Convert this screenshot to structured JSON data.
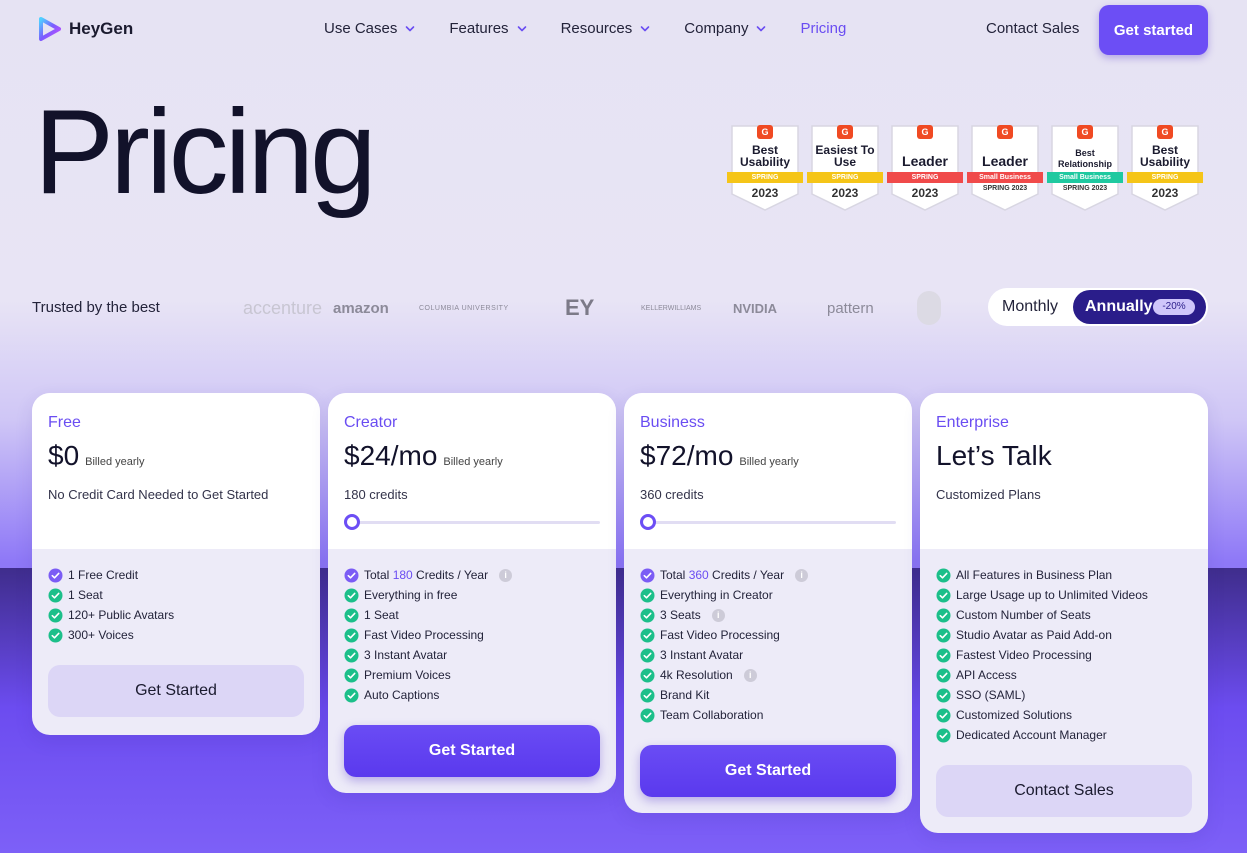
{
  "brand": {
    "name": "HeyGen",
    "accent": "#6c4ef5"
  },
  "nav": {
    "items": [
      {
        "label": "Use Cases",
        "dropdown": true
      },
      {
        "label": "Features",
        "dropdown": true
      },
      {
        "label": "Resources",
        "dropdown": true
      },
      {
        "label": "Company",
        "dropdown": true
      },
      {
        "label": "Pricing",
        "dropdown": false,
        "active": true
      }
    ],
    "contact": "Contact Sales",
    "cta": "Get started"
  },
  "hero": {
    "title": "Pricing"
  },
  "badges": [
    {
      "title": "Best Usability",
      "ribbon": "SPRING",
      "ribbon_color": "#f5c518",
      "year": "2023"
    },
    {
      "title": "Easiest To Use",
      "ribbon": "SPRING",
      "ribbon_color": "#f5c518",
      "year": "2023"
    },
    {
      "title": "Leader",
      "ribbon": "SPRING",
      "ribbon_color": "#f04a4a",
      "year": "2023"
    },
    {
      "title": "Leader",
      "ribbon": "Small Business",
      "ribbon_color": "#f04a4a",
      "season": "SPRING 2023"
    },
    {
      "title": "Best Relationship",
      "ribbon": "Small Business",
      "ribbon_color": "#1fc9a0",
      "season": "SPRING 2023"
    },
    {
      "title": "Best Usability",
      "ribbon": "SPRING",
      "ribbon_color": "#f5c518",
      "year": "2023"
    }
  ],
  "trusted": {
    "label": "Trusted by the best",
    "logos": [
      "accenture",
      "amazon",
      "COLUMBIA UNIVERSITY",
      "EY",
      "KELLERWILLIAMS",
      "NVIDIA",
      "pattern"
    ]
  },
  "billing_toggle": {
    "monthly": "Monthly",
    "annually": "Annually",
    "discount": "-20%",
    "selected": "annually"
  },
  "plans": [
    {
      "name": "Free",
      "price": "$0",
      "billed": "Billed yearly",
      "subtitle": "No Credit Card Needed to Get Started",
      "features": [
        {
          "text": "1 Free Credit",
          "check": "purple"
        },
        {
          "text": "1 Seat"
        },
        {
          "text": "120+ Public Avatars"
        },
        {
          "text": "300+ Voices"
        }
      ],
      "cta": "Get Started",
      "cta_style": "light"
    },
    {
      "name": "Creator",
      "price": "$24/mo",
      "billed": "Billed yearly",
      "subtitle": "180 credits",
      "slider": 0.0,
      "features": [
        {
          "pre": "Total ",
          "hl": "180",
          "post": " Credits / Year",
          "info": true,
          "check": "purple"
        },
        {
          "text": "Everything in free"
        },
        {
          "text": "1 Seat"
        },
        {
          "text": "Fast Video Processing"
        },
        {
          "text": "3 Instant Avatar"
        },
        {
          "text": "Premium Voices"
        },
        {
          "text": "Auto Captions"
        }
      ],
      "cta": "Get Started",
      "cta_style": "primary"
    },
    {
      "name": "Business",
      "price": "$72/mo",
      "billed": "Billed yearly",
      "subtitle": "360 credits",
      "slider": 0.0,
      "features": [
        {
          "pre": "Total ",
          "hl": "360",
          "post": " Credits / Year",
          "info": true,
          "check": "purple"
        },
        {
          "text": "Everything in Creator"
        },
        {
          "text": "3 Seats",
          "info": true
        },
        {
          "text": "Fast Video Processing"
        },
        {
          "text": "3 Instant Avatar"
        },
        {
          "text": "4k Resolution",
          "info": true
        },
        {
          "text": "Brand Kit"
        },
        {
          "text": "Team Collaboration"
        }
      ],
      "cta": "Get Started",
      "cta_style": "primary"
    },
    {
      "name": "Enterprise",
      "price": "Let’s Talk",
      "billed": "",
      "subtitle": "Customized Plans",
      "features": [
        {
          "text": "All Features in Business Plan"
        },
        {
          "text": "Large Usage up to Unlimited Videos"
        },
        {
          "text": "Custom Number of Seats"
        },
        {
          "text": "Studio Avatar as Paid Add-on"
        },
        {
          "text": "Fastest Video Processing"
        },
        {
          "text": "API Access"
        },
        {
          "text": "SSO (SAML)"
        },
        {
          "text": "Customized Solutions"
        },
        {
          "text": "Dedicated Account Manager"
        }
      ],
      "cta": "Contact Sales",
      "cta_style": "light"
    }
  ]
}
